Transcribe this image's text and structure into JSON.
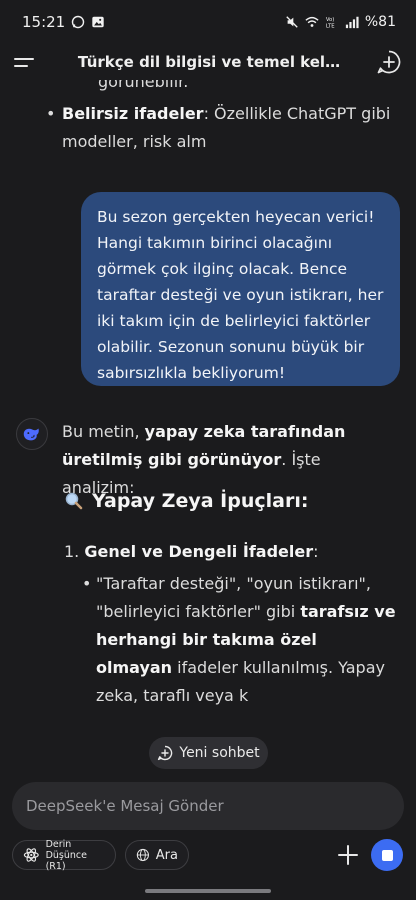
{
  "status_bar": {
    "time": "15:21",
    "battery": "%81",
    "net_label": "Vo)\nLTE"
  },
  "header": {
    "title": "Türkçe dil bilgisi ve temel kel…"
  },
  "chat": {
    "cut_text": "görünebilir.",
    "bullet_bold": "Belirsiz ifadeler",
    "bullet_rest": ": Özellikle ChatGPT gibi modeller, risk alm",
    "user_message": "Bu sezon gerçekten heyecan verici! Hangi takımın birinci olacağını görmek çok ilginç olacak. Bence taraftar desteği ve oyun istikrarı, her iki takım için de belirleyici faktörler olabilir. Sezonun sonunu büyük bir sabırsızlıkla bekliyorum!",
    "ai_intro_a": "Bu metin, ",
    "ai_intro_bold": "yapay zeka tarafından üretilmiş gibi görünüyor",
    "ai_intro_b": ". İşte analizim:",
    "ai_heading": "Yapay Zeya İpuçları:",
    "list_number": "1.",
    "list_item_bold": "Genel ve Dengeli İfadeler",
    "list_item_colon": ":",
    "sub_a": "\"Taraftar desteği\", \"oyun istikrarı\", \"belirleyici faktörler\" gibi ",
    "sub_bold": "tarafsız ve herhangi bir takıma özel olmayan",
    "sub_b": " ifadeler kullanılmış. Yapay zeka, taraflı veya k"
  },
  "new_chat_label": "Yeni sohbet",
  "composer": {
    "placeholder": "DeepSeek'e Mesaj Gönder"
  },
  "toolbar": {
    "deep_line1": "Derin",
    "deep_line2": "Düşünce (R1)",
    "search_label": "Ara"
  },
  "colors": {
    "background": "#1b1b1d",
    "user_bubble": "#2c4a7c",
    "accent": "#3c6cf2"
  }
}
